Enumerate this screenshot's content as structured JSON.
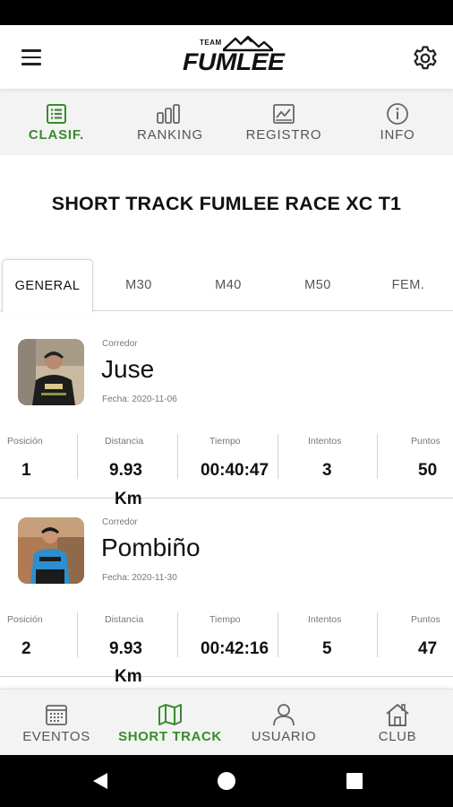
{
  "header": {
    "logo_team": "TEAM",
    "logo_word": "FUMLEE",
    "menu_icon": "hamburger-menu-icon",
    "settings_icon": "gear-icon"
  },
  "top_tabs": [
    {
      "label": "CLASIF.",
      "icon": "list-document-icon",
      "active": true
    },
    {
      "label": "RANKING",
      "icon": "bars-icon",
      "active": false
    },
    {
      "label": "REGISTRO",
      "icon": "chart-image-icon",
      "active": false
    },
    {
      "label": "INFO",
      "icon": "info-circle-icon",
      "active": false
    }
  ],
  "event_title": "SHORT TRACK FUMLEE RACE XC T1",
  "category_tabs": [
    {
      "label": "GENERAL",
      "active": true
    },
    {
      "label": "M30",
      "active": false
    },
    {
      "label": "M40",
      "active": false
    },
    {
      "label": "M50",
      "active": false
    },
    {
      "label": "FEM.",
      "active": false
    }
  ],
  "stat_labels": {
    "position": "Posición",
    "distance": "Distancia",
    "time": "Tiempo",
    "attempts": "Intentos",
    "points": "Puntos"
  },
  "entries": [
    {
      "caption": "Corredor",
      "name": "Juse",
      "date": "Fecha: 2020-11-06",
      "position": "1",
      "distance": "9.93",
      "distance_unit": "Km",
      "time": "00:40:47",
      "attempts": "3",
      "points": "50"
    },
    {
      "caption": "Corredor",
      "name": "Pombiño",
      "date": "Fecha: 2020-11-30",
      "position": "2",
      "distance": "9.93",
      "distance_unit": "Km",
      "time": "00:42:16",
      "attempts": "5",
      "points": "47"
    }
  ],
  "bottom_nav": [
    {
      "label": "EVENTOS",
      "icon": "calendar-icon",
      "active": false
    },
    {
      "label": "SHORT TRACK",
      "icon": "map-icon",
      "active": true
    },
    {
      "label": "USUARIO",
      "icon": "user-icon",
      "active": false
    },
    {
      "label": "CLUB",
      "icon": "home-icon",
      "active": false
    }
  ],
  "colors": {
    "accent_green": "#3a8a2e",
    "tab_background": "#f3f3f3",
    "system_bar": "#000000"
  }
}
